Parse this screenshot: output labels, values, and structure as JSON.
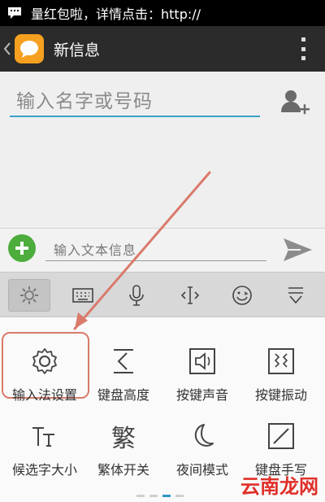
{
  "status_bar": {
    "notification_text": "量红包啦，详情点击：http://"
  },
  "action_bar": {
    "title": "新信息"
  },
  "recipient": {
    "placeholder": "输入名字或号码"
  },
  "compose": {
    "placeholder": "输入文本信息"
  },
  "keyboard_toolbar": {
    "items": [
      {
        "icon": "gear-icon",
        "active": true
      },
      {
        "icon": "keyboard-icon"
      },
      {
        "icon": "microphone-icon"
      },
      {
        "icon": "text-cursor-icon"
      },
      {
        "icon": "emoji-icon"
      },
      {
        "icon": "collapse-keyboard-icon"
      }
    ]
  },
  "settings_grid": {
    "items": [
      {
        "label": "输入法设置",
        "icon": "gear-icon"
      },
      {
        "label": "键盘高度",
        "icon": "keyboard-height-icon"
      },
      {
        "label": "按键声音",
        "icon": "speaker-icon"
      },
      {
        "label": "按键振动",
        "icon": "vibration-icon"
      },
      {
        "label": "候选字大小",
        "icon": "font-size-icon"
      },
      {
        "label": "繁体开关",
        "icon": "traditional-chinese-icon",
        "glyph": "繁"
      },
      {
        "label": "夜间模式",
        "icon": "moon-icon"
      },
      {
        "label": "键盘手写",
        "icon": "handwriting-icon"
      }
    ],
    "page_count": 4,
    "active_page": 3
  },
  "watermark": "云南龙网",
  "colors": {
    "accent": "#3aa2c8",
    "annotation": "#d97a6a",
    "add_green": "#4cad3c",
    "app_orange": "#f5a020"
  }
}
